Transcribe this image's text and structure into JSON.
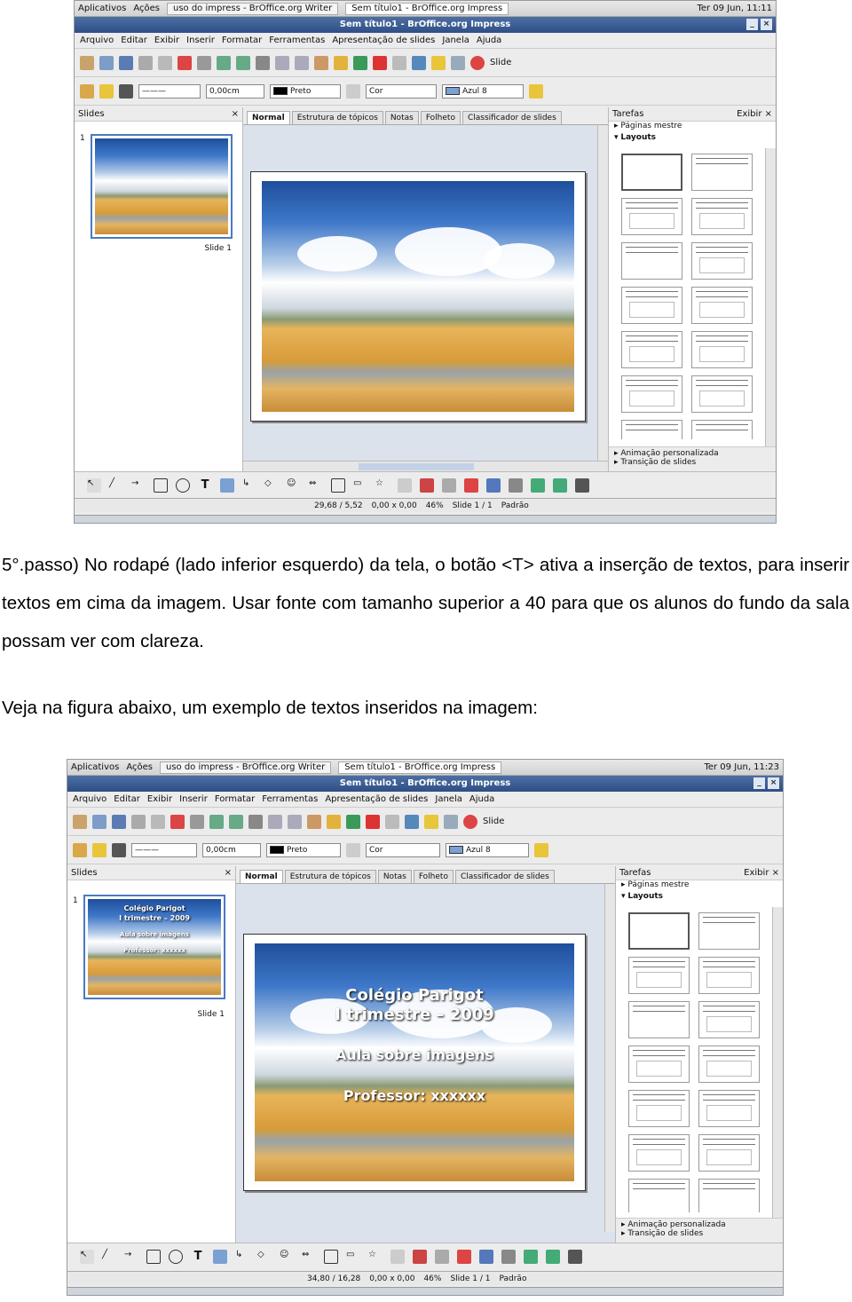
{
  "screenshot_1": {
    "topbar": {
      "apps": "Aplicativos",
      "actions": "Ações",
      "task1": "uso do impress - BrOffice.org Writer",
      "task2": "Sem título1 - BrOffice.org Impress",
      "clock": "Ter 09 Jun, 11:11"
    },
    "window_title": "Sem título1 - BrOffice.org Impress",
    "menu": [
      "Arquivo",
      "Editar",
      "Exibir",
      "Inserir",
      "Formatar",
      "Ferramentas",
      "Apresentação de slides",
      "Janela",
      "Ajuda"
    ],
    "toolbar": {
      "slide_label": "Slide",
      "line_width": "0,00cm",
      "line_color": "Preto",
      "fill_mode": "Cor",
      "fill_color": "Azul 8"
    },
    "slides_pane": {
      "title": "Slides",
      "slide_number": "1",
      "slide_label": "Slide 1"
    },
    "view_tabs": [
      "Normal",
      "Estrutura de tópicos",
      "Notas",
      "Folheto",
      "Classificador de slides"
    ],
    "tasks": {
      "title": "Tarefas",
      "view": "Exibir",
      "master_pages": "Páginas mestre",
      "layouts": "Layouts",
      "custom_animation": "Animação personalizada",
      "slide_transition": "Transição de slides"
    },
    "status": {
      "position": "29,68 / 5,52",
      "size": "0,00 x 0,00",
      "zoom": "46%",
      "slide": "Slide 1 / 1",
      "master": "Padrão"
    },
    "slide_text": []
  },
  "paragraph_1": "5°.passo) No rodapé (lado inferior esquerdo) da tela, o botão <T> ativa a inserção de textos, para inserir textos em cima da imagem. Usar fonte com tamanho superior a 40 para que os alunos do fundo da sala possam ver com clareza.",
  "paragraph_2": "Veja na figura abaixo, um exemplo de textos inseridos na imagem:",
  "screenshot_2": {
    "topbar": {
      "apps": "Aplicativos",
      "actions": "Ações",
      "task1": "uso do impress - BrOffice.org Writer",
      "task2": "Sem título1 - BrOffice.org Impress",
      "clock": "Ter 09 Jun, 11:23"
    },
    "window_title": "Sem título1 - BrOffice.org Impress",
    "menu": [
      "Arquivo",
      "Editar",
      "Exibir",
      "Inserir",
      "Formatar",
      "Ferramentas",
      "Apresentação de slides",
      "Janela",
      "Ajuda"
    ],
    "toolbar": {
      "slide_label": "Slide",
      "line_width": "0,00cm",
      "line_color": "Preto",
      "fill_mode": "Cor",
      "fill_color": "Azul 8"
    },
    "slides_pane": {
      "title": "Slides",
      "slide_number": "1",
      "slide_label": "Slide 1"
    },
    "view_tabs": [
      "Normal",
      "Estrutura de tópicos",
      "Notas",
      "Folheto",
      "Classificador de slides"
    ],
    "tasks": {
      "title": "Tarefas",
      "view": "Exibir",
      "master_pages": "Páginas mestre",
      "layouts": "Layouts",
      "custom_animation": "Animação personalizada",
      "slide_transition": "Transição de slides"
    },
    "status": {
      "position": "34,80 / 16,28",
      "size": "0,00 x 0,00",
      "zoom": "46%",
      "slide": "Slide 1 / 1",
      "master": "Padrão"
    },
    "slide_text": [
      "Colégio Parigot",
      "I trimestre – 2009",
      "Aula sobre imagens",
      "Professor: xxxxxx"
    ]
  },
  "colors": {
    "titlebar": "#2e4f86",
    "selection": "#4a7abf",
    "fill_swatch": "#7aa0d4"
  }
}
